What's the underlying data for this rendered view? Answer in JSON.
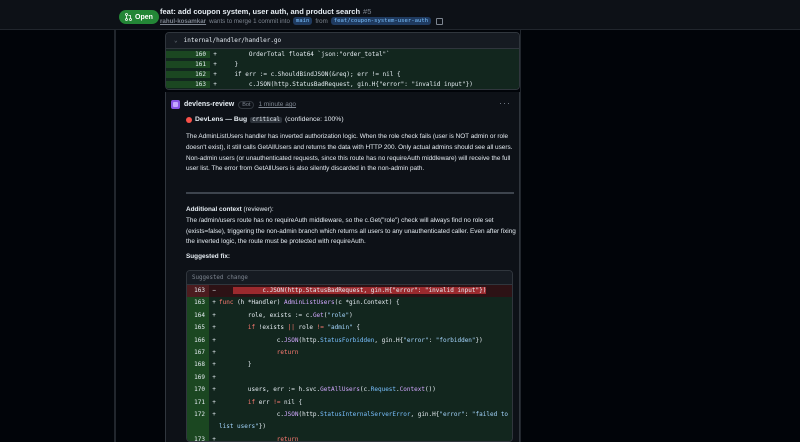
{
  "header": {
    "status": "Open",
    "title": "feat: add coupon system, user auth, and product search",
    "number": "#5",
    "author": "rahul-kosamkar",
    "merge_text": "wants to merge 1 commit into",
    "base_branch": "main",
    "from_text": "from",
    "head_branch": "feat/coupon-system-user-auth"
  },
  "diff": {
    "toggle": "⌄",
    "file_path": "internal/handler/handler.go",
    "lines": [
      {
        "num": "160",
        "sign": "+",
        "code": "        OrderTotal float64 `json:\"order_total\"`"
      },
      {
        "num": "161",
        "sign": "+",
        "code": "    }"
      },
      {
        "num": "162",
        "sign": "+",
        "code": "    if err := c.ShouldBindJSON(&req); err != nil {"
      },
      {
        "num": "163",
        "sign": "+",
        "code": "        c.JSON(http.StatusBadRequest, gin.H{\"error\": \"invalid input\"})"
      }
    ]
  },
  "comment": {
    "author": "devlens-review",
    "badge": "Bot",
    "time": "1 minute ago",
    "menu": "···",
    "title_label": "DevLens — Bug",
    "severity": "critical",
    "confidence": "(confidence: 100%)",
    "body": "The AdminListUsers handler has inverted authorization logic. When the role check fails (user is NOT admin or role doesn't exist), it still calls GetAllUsers and returns the data with HTTP 200. Only actual admins should see all users. Non-admin users (or unauthenticated requests, since this route has no requireAuth middleware) will receive the full user list. The error from GetAllUsers is also silently discarded in the non-admin path.",
    "context_label": "Additional context",
    "context_suffix": " (reviewer):",
    "context_body": "The /admin/users route has no requireAuth middleware, so the c.Get(\"role\") check will always find no role set (exists=false), triggering the non-admin branch which returns all users to any unauthenticated caller. Even after fixing the inverted logic, the route must be protected with requireAuth.",
    "suggested_label": "Suggested fix:"
  },
  "suggestion": {
    "header": "Suggested change",
    "lines": [
      {
        "num": "163",
        "sign": "−",
        "type": "del",
        "parts": [
          [
            "",
            "    "
          ],
          [
            "delhl",
            "        c.JSON(http.StatusBadRequest, gin.H{\"error\": \"invalid input\"})"
          ]
        ]
      },
      {
        "num": "163",
        "sign": "+",
        "type": "add",
        "parts": [
          [
            "kw",
            "func"
          ],
          [
            "",
            " (h *Handler) "
          ],
          [
            "fn",
            "AdminListUsers"
          ],
          [
            "",
            "(c *gin.Context) {"
          ]
        ]
      },
      {
        "num": "164",
        "sign": "+",
        "type": "add",
        "parts": [
          [
            "",
            "        role, exists := c."
          ],
          [
            "fn",
            "Get"
          ],
          [
            "",
            "("
          ],
          [
            "str",
            "\"role\""
          ],
          [
            "",
            ")"
          ]
        ]
      },
      {
        "num": "165",
        "sign": "+",
        "type": "add",
        "parts": [
          [
            "",
            "        "
          ],
          [
            "kw",
            "if"
          ],
          [
            "",
            " !exists "
          ],
          [
            "kw",
            "||"
          ],
          [
            "",
            " role "
          ],
          [
            "kw",
            "!="
          ],
          [
            "",
            " "
          ],
          [
            "str",
            "\"admin\""
          ],
          [
            "",
            " {"
          ]
        ]
      },
      {
        "num": "166",
        "sign": "+",
        "type": "add",
        "parts": [
          [
            "",
            "                c."
          ],
          [
            "fn",
            "JSON"
          ],
          [
            "",
            "(http."
          ],
          [
            "ty",
            "StatusForbidden"
          ],
          [
            "",
            ", gin.H{"
          ],
          [
            "str",
            "\"error\""
          ],
          [
            "",
            ": "
          ],
          [
            "str",
            "\"forbidden\""
          ],
          [
            "",
            "})"
          ]
        ]
      },
      {
        "num": "167",
        "sign": "+",
        "type": "add",
        "parts": [
          [
            "",
            "                "
          ],
          [
            "kw",
            "return"
          ]
        ]
      },
      {
        "num": "168",
        "sign": "+",
        "type": "add",
        "parts": [
          [
            "",
            "        }"
          ]
        ]
      },
      {
        "num": "169",
        "sign": "+",
        "type": "add",
        "parts": [
          [
            "",
            ""
          ]
        ]
      },
      {
        "num": "170",
        "sign": "+",
        "type": "add",
        "parts": [
          [
            "",
            "        users, err := h.svc."
          ],
          [
            "fn",
            "GetAllUsers"
          ],
          [
            "",
            "(c."
          ],
          [
            "ty",
            "Request"
          ],
          [
            "",
            "."
          ],
          [
            "fn",
            "Context"
          ],
          [
            "",
            "())"
          ]
        ]
      },
      {
        "num": "171",
        "sign": "+",
        "type": "add",
        "parts": [
          [
            "",
            "        "
          ],
          [
            "kw",
            "if"
          ],
          [
            "",
            " err "
          ],
          [
            "kw",
            "!="
          ],
          [
            "",
            " nil {"
          ]
        ]
      },
      {
        "num": "172",
        "sign": "+",
        "type": "add",
        "parts": [
          [
            "",
            "                c."
          ],
          [
            "fn",
            "JSON"
          ],
          [
            "",
            "(http."
          ],
          [
            "ty",
            "StatusInternalServerError"
          ],
          [
            "",
            ", gin.H{"
          ],
          [
            "str",
            "\"error\""
          ],
          [
            "",
            ": "
          ],
          [
            "str",
            "\"failed to list users\""
          ],
          [
            "",
            "})"
          ]
        ]
      },
      {
        "num": "173",
        "sign": "+",
        "type": "add",
        "parts": [
          [
            "",
            "                "
          ],
          [
            "kw",
            "return"
          ]
        ]
      }
    ]
  }
}
